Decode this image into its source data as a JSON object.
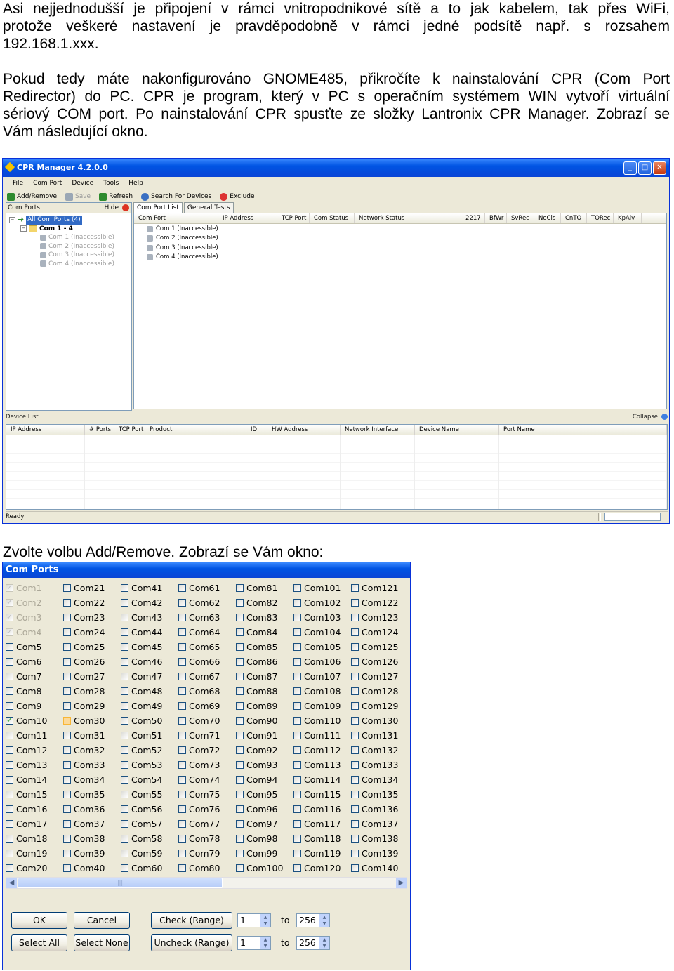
{
  "intro": {
    "p1_lines": [
      "Asi nejjednodušší je připojení v rámci vnitropodnikové sítě a to jak kabelem, tak přes WiFi,",
      "protože veškeré nastavení je pravděpodobně v rámci jedné podsítě např. s rozsahem",
      "192.168.1.xxx."
    ],
    "p2_lines": [
      "Pokud tedy máte nakonfigurováno GNOME485, přikročíte k nainstalování CPR (Com Port",
      "Redirector) do PC. CPR je program, který v PC s operačním systémem WIN vytvoří virtuální",
      "sériový COM port. Po nainstalování CPR spusťte ze složky Lantronix CPR Manager. Zobrazí se",
      "Vám následující okno."
    ],
    "p3": "Zvolte volbu Add/Remove. Zobrazí se Vám okno:"
  },
  "cpr": {
    "title": "CPR Manager 4.2.0.0",
    "menu": [
      "File",
      "Com Port",
      "Device",
      "Tools",
      "Help"
    ],
    "toolbar": [
      {
        "label": "Add/Remove",
        "icon": "add-remove-icon",
        "color": "#2e8b2e"
      },
      {
        "label": "Save",
        "icon": "save-icon",
        "color": "#9aa7b5"
      },
      {
        "label": "Refresh",
        "icon": "refresh-icon",
        "color": "#2e8b2e"
      },
      {
        "label": "Search For Devices",
        "icon": "search-icon",
        "color": "#3a6fc2"
      },
      {
        "label": "Exclude",
        "icon": "exclude-icon",
        "color": "#d33"
      }
    ],
    "left_header": "Com Ports",
    "hide": "Hide",
    "tree": {
      "root": "All Com Ports (4)",
      "group": "Com 1 - 4",
      "items": [
        "Com 1 (Inaccessible)",
        "Com 2 (Inaccessible)",
        "Com 3 (Inaccessible)",
        "Com 4 (Inaccessible)"
      ]
    },
    "tabs": [
      "Com Port List",
      "General Tests"
    ],
    "columns": [
      "Com Port",
      "IP Address",
      "TCP Port",
      "Com Status",
      "Network Status",
      "2217",
      "BfWr",
      "SvRec",
      "NoCls",
      "CnTO",
      "TORec",
      "KpAlv"
    ],
    "rows": [
      "Com 1 (Inaccessible)",
      "Com 2 (Inaccessible)",
      "Com 3 (Inaccessible)",
      "Com 4 (Inaccessible)"
    ],
    "device_list": "Device List",
    "collapse": "Collapse",
    "device_columns": [
      "IP Address",
      "# Ports",
      "TCP Port",
      "Product",
      "ID",
      "HW Address",
      "Network Interface",
      "Device Name",
      "Port Name"
    ],
    "status": "Ready"
  },
  "comports": {
    "title": "Com Ports",
    "ports": [
      "Com1",
      "Com2",
      "Com3",
      "Com4",
      "Com5",
      "Com6",
      "Com7",
      "Com8",
      "Com9",
      "Com10",
      "Com11",
      "Com12",
      "Com13",
      "Com14",
      "Com15",
      "Com16",
      "Com17",
      "Com18",
      "Com19",
      "Com20",
      "Com21",
      "Com22",
      "Com23",
      "Com24",
      "Com25",
      "Com26",
      "Com27",
      "Com28",
      "Com29",
      "Com30",
      "Com31",
      "Com32",
      "Com33",
      "Com34",
      "Com35",
      "Com36",
      "Com37",
      "Com38",
      "Com39",
      "Com40",
      "Com41",
      "Com42",
      "Com43",
      "Com44",
      "Com45",
      "Com46",
      "Com47",
      "Com48",
      "Com49",
      "Com50",
      "Com51",
      "Com52",
      "Com53",
      "Com54",
      "Com55",
      "Com56",
      "Com57",
      "Com58",
      "Com59",
      "Com60",
      "Com61",
      "Com62",
      "Com63",
      "Com64",
      "Com65",
      "Com66",
      "Com67",
      "Com68",
      "Com69",
      "Com70",
      "Com71",
      "Com72",
      "Com73",
      "Com74",
      "Com75",
      "Com76",
      "Com77",
      "Com78",
      "Com79",
      "Com80",
      "Com81",
      "Com82",
      "Com83",
      "Com84",
      "Com85",
      "Com86",
      "Com87",
      "Com88",
      "Com89",
      "Com90",
      "Com91",
      "Com92",
      "Com93",
      "Com94",
      "Com95",
      "Com96",
      "Com97",
      "Com98",
      "Com99",
      "Com100",
      "Com101",
      "Com102",
      "Com103",
      "Com104",
      "Com105",
      "Com106",
      "Com107",
      "Com108",
      "Com109",
      "Com110",
      "Com111",
      "Com112",
      "Com113",
      "Com114",
      "Com115",
      "Com116",
      "Com117",
      "Com118",
      "Com119",
      "Com120",
      "Com121",
      "Com122",
      "Com123",
      "Com124",
      "Com125",
      "Com126",
      "Com127",
      "Com128",
      "Com129",
      "Com130",
      "Com131",
      "Com132",
      "Com133",
      "Com134",
      "Com135",
      "Com136",
      "Com137",
      "Com138",
      "Com139",
      "Com140"
    ],
    "disabled_checked": [
      "Com1",
      "Com2",
      "Com3",
      "Com4"
    ],
    "checked": [
      "Com10"
    ],
    "hovered": [
      "Com30"
    ],
    "buttons": {
      "ok": "OK",
      "cancel": "Cancel",
      "select_all": "Select All",
      "select_none": "Select None",
      "check_range": "Check (Range)",
      "uncheck_range": "Uncheck (Range)"
    },
    "range": {
      "from1": "1",
      "to1": "256",
      "from2": "1",
      "to2": "256",
      "to_label": "to"
    }
  }
}
